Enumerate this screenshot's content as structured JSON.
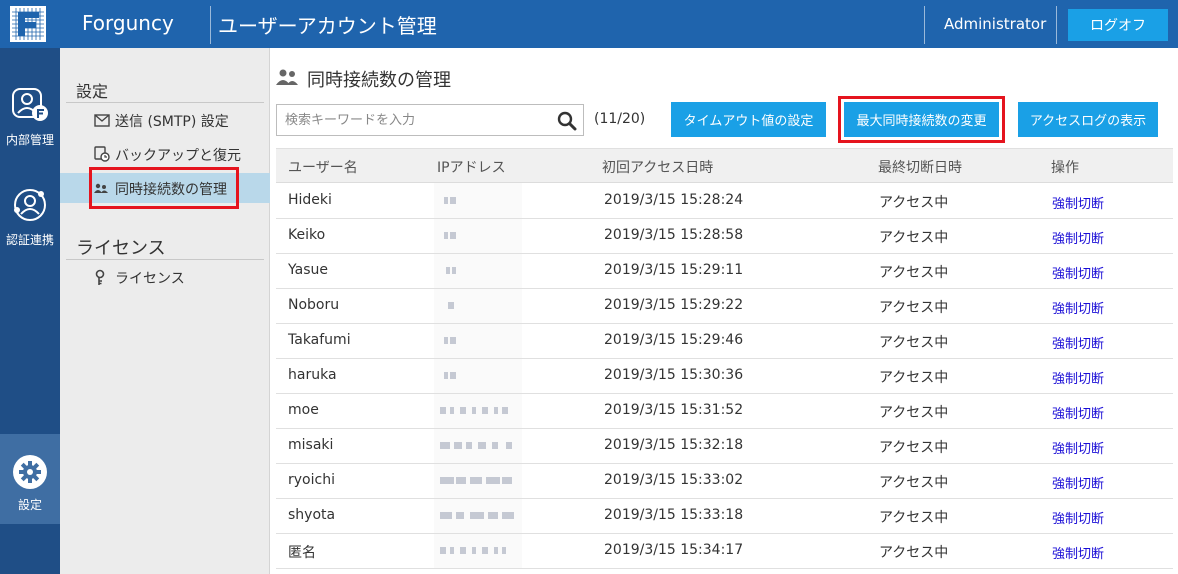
{
  "header": {
    "brand": "Forguncy",
    "title": "ユーザーアカウント管理",
    "user": "Administrator",
    "logout_label": "ログオフ",
    "bg_color": "#1f64ad"
  },
  "rail": {
    "items": [
      {
        "label": "内部管理",
        "icon": "user-badge-icon"
      },
      {
        "label": "認証連携",
        "icon": "user-sync-icon"
      },
      {
        "label": "設定",
        "icon": "gear-icon"
      }
    ]
  },
  "menu": {
    "section1": "設定",
    "items1": [
      {
        "label": "送信 (SMTP) 設定",
        "icon": "mail-icon"
      },
      {
        "label": "バックアップと復元",
        "icon": "backup-icon"
      },
      {
        "label": "同時接続数の管理",
        "icon": "users-icon"
      }
    ],
    "section2": "ライセンス",
    "items2": [
      {
        "label": "ライセンス",
        "icon": "key-icon"
      }
    ]
  },
  "main": {
    "title": "同時接続数の管理",
    "search_placeholder": "検索キーワードを入力",
    "count": "(11/20)",
    "buttons": {
      "timeout": "タイムアウト値の設定",
      "max_conn": "最大同時接続数の変更",
      "access_log": "アクセスログの表示"
    },
    "accent_color": "#1aa0e6",
    "highlight_color": "#e5141e"
  },
  "table": {
    "columns": [
      "ユーザー名",
      "IPアドレス",
      "初回アクセス日時",
      "最終切断日時",
      "操作"
    ],
    "rows": [
      {
        "user": "Hideki",
        "first": "2019/3/15 15:28:24",
        "last": "アクセス中",
        "action": "強制切断"
      },
      {
        "user": "Keiko",
        "first": "2019/3/15 15:28:58",
        "last": "アクセス中",
        "action": "強制切断"
      },
      {
        "user": "Yasue",
        "first": "2019/3/15 15:29:11",
        "last": "アクセス中",
        "action": "強制切断"
      },
      {
        "user": "Noboru",
        "first": "2019/3/15 15:29:22",
        "last": "アクセス中",
        "action": "強制切断"
      },
      {
        "user": "Takafumi",
        "first": "2019/3/15 15:29:46",
        "last": "アクセス中",
        "action": "強制切断"
      },
      {
        "user": "haruka",
        "first": "2019/3/15 15:30:36",
        "last": "アクセス中",
        "action": "強制切断"
      },
      {
        "user": "moe",
        "first": "2019/3/15 15:31:52",
        "last": "アクセス中",
        "action": "強制切断"
      },
      {
        "user": "misaki",
        "first": "2019/3/15 15:32:18",
        "last": "アクセス中",
        "action": "強制切断"
      },
      {
        "user": "ryoichi",
        "first": "2019/3/15 15:33:02",
        "last": "アクセス中",
        "action": "強制切断"
      },
      {
        "user": "shyota",
        "first": "2019/3/15 15:33:18",
        "last": "アクセス中",
        "action": "強制切断"
      },
      {
        "user": "匿名",
        "first": "2019/3/15 15:34:17",
        "last": "アクセス中",
        "action": "強制切断"
      }
    ]
  }
}
